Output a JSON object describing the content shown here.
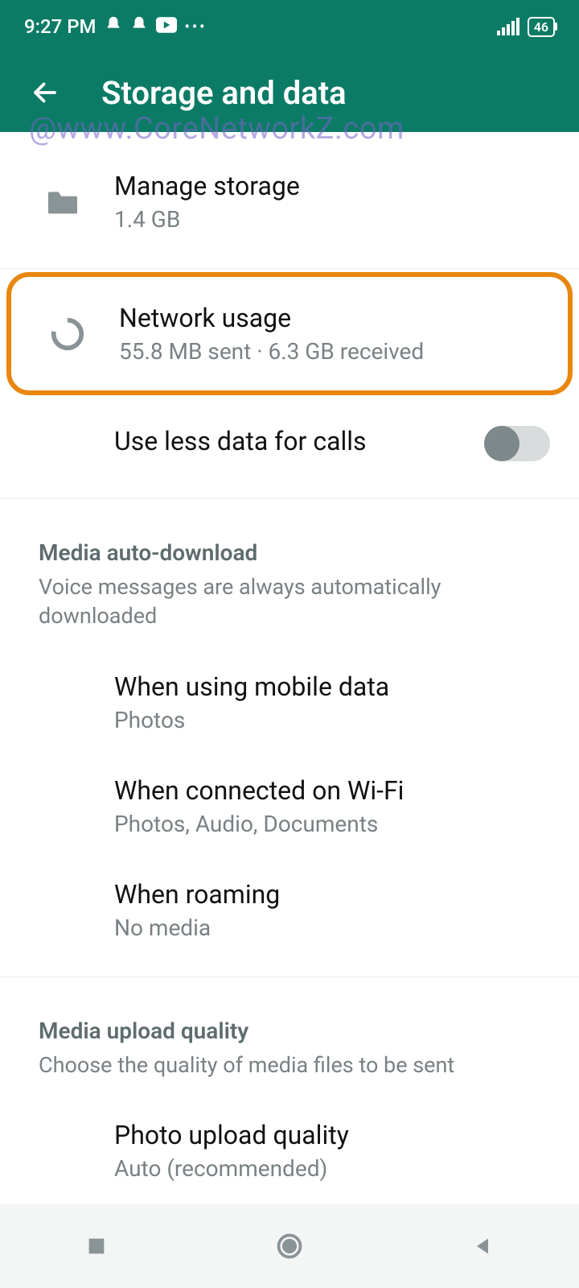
{
  "statusbar": {
    "time": "9:27 PM",
    "battery": "46"
  },
  "appbar": {
    "title": "Storage and data"
  },
  "watermark": "@www.CoreNetworkZ.com",
  "rows": {
    "manage_storage": {
      "title": "Manage storage",
      "subtitle": "1.4 GB"
    },
    "network_usage": {
      "title": "Network usage",
      "subtitle": "55.8 MB sent · 6.3 GB received"
    },
    "use_less_data": {
      "title": "Use less data for calls"
    }
  },
  "section_media_auto": {
    "title": "Media auto-download",
    "desc": "Voice messages are always automatically downloaded",
    "mobile": {
      "title": "When using mobile data",
      "subtitle": "Photos"
    },
    "wifi": {
      "title": "When connected on Wi-Fi",
      "subtitle": "Photos, Audio, Documents"
    },
    "roaming": {
      "title": "When roaming",
      "subtitle": "No media"
    }
  },
  "section_upload": {
    "title": "Media upload quality",
    "desc": "Choose the quality of media files to be sent",
    "photo": {
      "title": "Photo upload quality",
      "subtitle": "Auto (recommended)"
    }
  }
}
